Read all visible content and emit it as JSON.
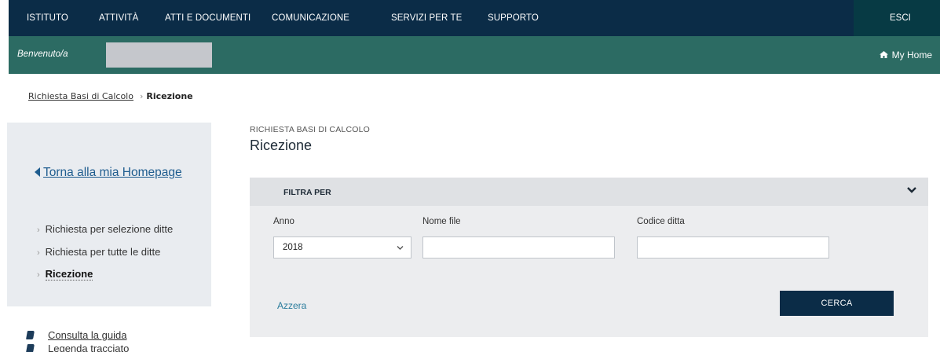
{
  "topnav": {
    "items": [
      "ISTITUTO",
      "ATTIVITÀ",
      "ATTI E DOCUMENTI",
      "COMUNICAZIONE",
      "SERVIZI PER TE",
      "SUPPORTO"
    ],
    "logout": "ESCI"
  },
  "welcome": {
    "label": "Benvenuto/a",
    "myhome": "My Home",
    "myhome_icon": "home-icon"
  },
  "breadcrumb": {
    "parent": "Richiesta Basi di Calcolo",
    "separator": "›",
    "current": "Ricezione"
  },
  "sidebar": {
    "back_link": "Torna alla mia Homepage",
    "items": [
      {
        "label": "Richiesta per selezione ditte",
        "active": false
      },
      {
        "label": "Richiesta per tutte le ditte",
        "active": false
      },
      {
        "label": "Ricezione",
        "active": true
      }
    ],
    "guides": [
      {
        "label": "Consulta la guida",
        "icon": "book-icon"
      },
      {
        "label": "Legenda tracciato",
        "icon": "book-icon"
      }
    ]
  },
  "main": {
    "subtitle": "RICHIESTA BASI DI CALCOLO",
    "title": "Ricezione"
  },
  "filter": {
    "title": "FILTRA PER",
    "anno_label": "Anno",
    "anno_value": "2018",
    "nome_file_label": "Nome file",
    "nome_file_value": "",
    "codice_ditta_label": "Codice ditta",
    "codice_ditta_value": "",
    "reset_label": "Azzera",
    "search_label": "CERCA"
  },
  "colors": {
    "nav_bg": "#0b2c47",
    "welcome_bg": "#2c6b63",
    "link": "#1f5d8f"
  }
}
